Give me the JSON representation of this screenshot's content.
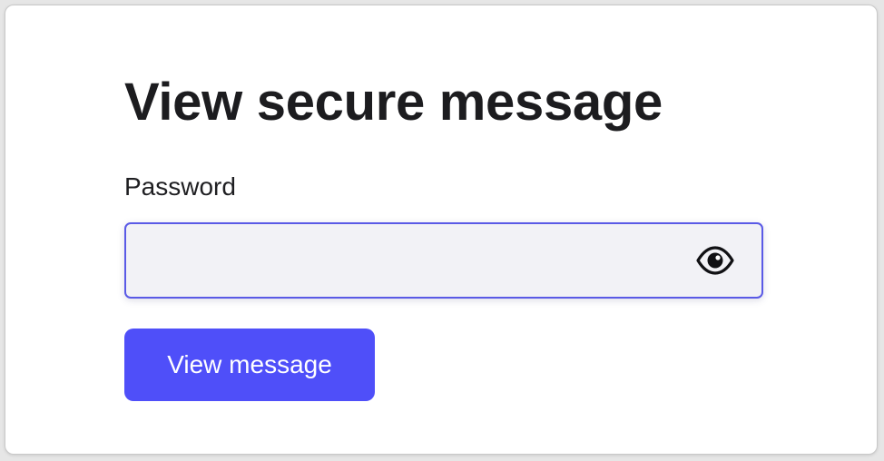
{
  "form": {
    "title": "View secure message",
    "password_label": "Password",
    "password_value": "",
    "password_placeholder": "",
    "visibility_icon": "eye-icon",
    "submit_label": "View message"
  },
  "colors": {
    "accent": "#4f4ff9",
    "input_border": "#5a5ae6",
    "input_background": "#f2f2f6",
    "text": "#1c1c1f"
  }
}
